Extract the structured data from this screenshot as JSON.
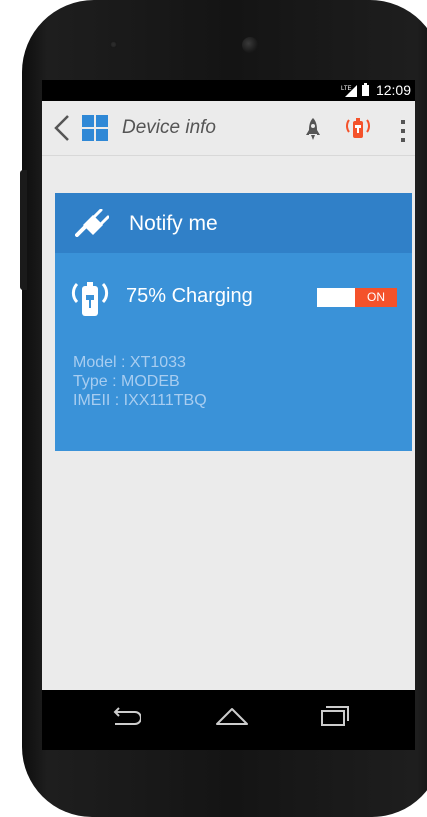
{
  "status_bar": {
    "network": "LTE",
    "time": "12:09"
  },
  "app_bar": {
    "title": "Device info",
    "icons": [
      "back-icon",
      "apps-grid-icon",
      "rocket-icon",
      "charging-icon",
      "overflow-menu-icon"
    ]
  },
  "card": {
    "title": "Notify me",
    "charging_text": "75% Charging",
    "toggle_label": "ON",
    "toggle_on": true,
    "model": "Model : XT1033",
    "type": "Type : MODEB",
    "imei": "IMEII : IXX111TBQ",
    "colors": {
      "header": "#3080c8",
      "body": "#3a92d8",
      "toggle_on": "#f4522b"
    }
  },
  "nav_bar": {
    "icons": [
      "back-nav-icon",
      "home-nav-icon",
      "recents-nav-icon"
    ]
  }
}
